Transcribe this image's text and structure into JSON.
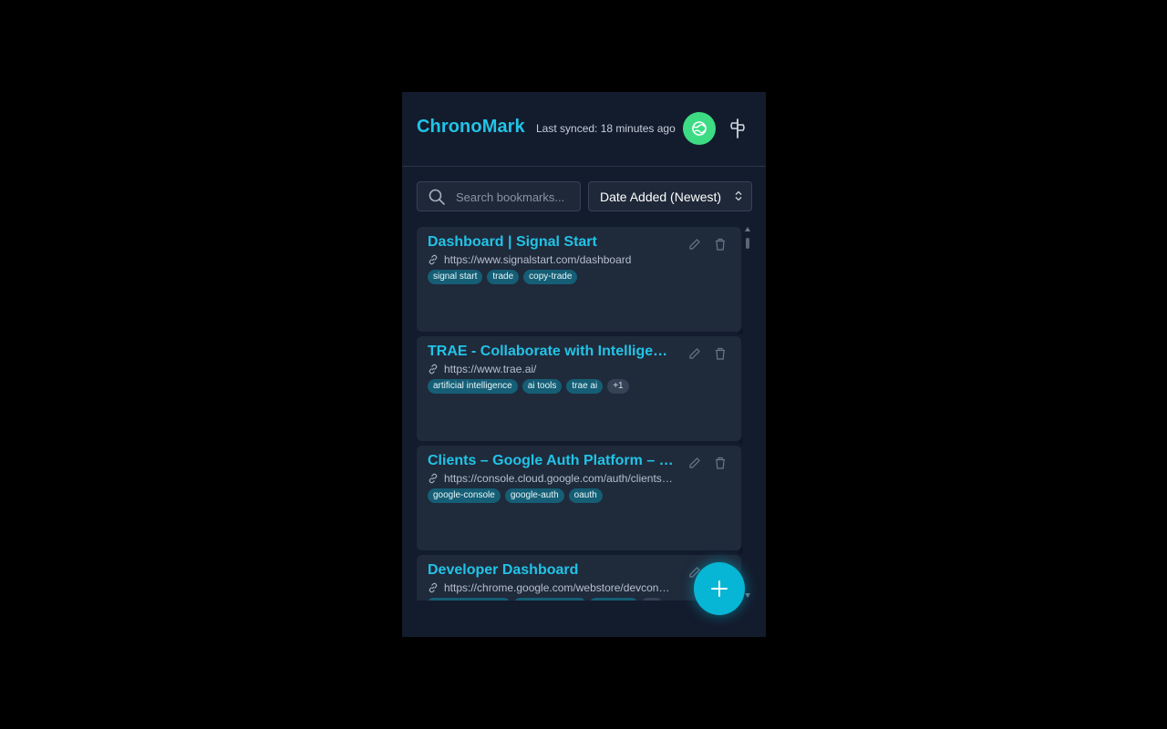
{
  "header": {
    "app_title": "ChronoMark",
    "sync_status": "Last synced: 18 minutes ago",
    "sync_button_icon": "sync-globe-icon",
    "menu_icon": "pin-menu-icon"
  },
  "search": {
    "placeholder": "Search bookmarks...",
    "value": ""
  },
  "sort": {
    "selected": "Date Added (Newest)"
  },
  "bookmarks": [
    {
      "title": "Dashboard | Signal Start",
      "url": "https://www.signalstart.com/dashboard",
      "tags": [
        "signal start",
        "trade",
        "copy-trade"
      ],
      "more": ""
    },
    {
      "title": "TRAE - Collaborate with Intelligence",
      "url": "https://www.trae.ai/",
      "tags": [
        "artificial intelligence",
        "ai tools",
        "trae ai"
      ],
      "more": "+1"
    },
    {
      "title": "Clients – Google Auth Platform – ChronoMark",
      "url": "https://console.cloud.google.com/auth/clients?project=chronomark",
      "tags": [
        "google-console",
        "google-auth",
        "oauth"
      ],
      "more": ""
    },
    {
      "title": "Developer Dashboard",
      "url": "https://chrome.google.com/webstore/devconsole",
      "tags": [],
      "more": ""
    }
  ],
  "fab": {
    "icon": "plus-icon"
  },
  "colors": {
    "accent": "#22c3e6",
    "background": "#131c2d",
    "card": "#1f2a3b",
    "sync_green": "#3ddc84",
    "tag_bg": "#155e75",
    "fab": "#06b6d4"
  }
}
